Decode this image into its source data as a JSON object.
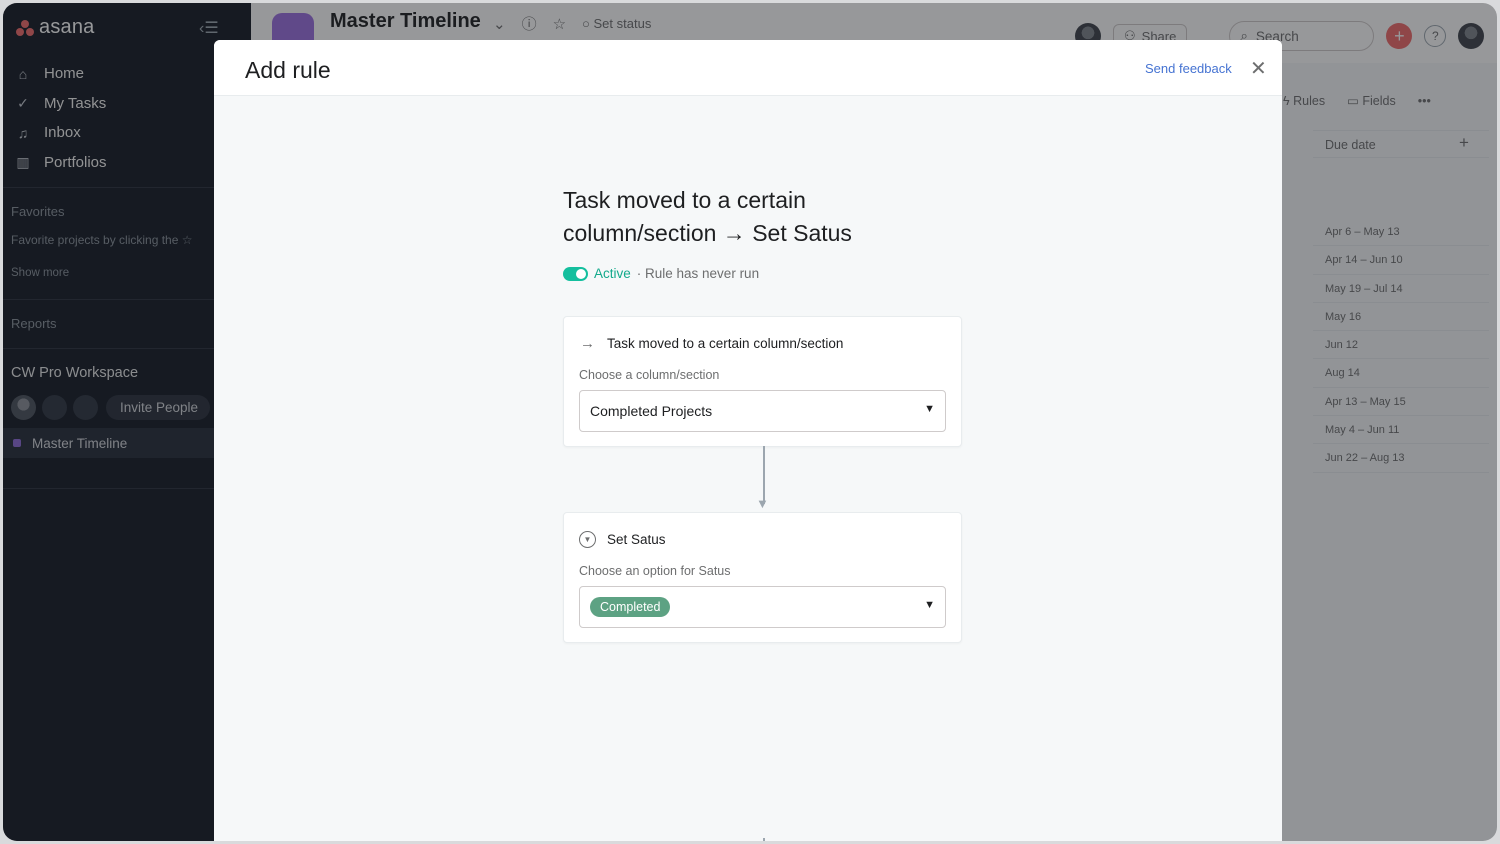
{
  "app": {
    "logo_text": "asana",
    "brand_color": "#f06a6a"
  },
  "sidebar": {
    "nav": [
      {
        "label": "Home",
        "icon": "home-icon"
      },
      {
        "label": "My Tasks",
        "icon": "check-circle-icon"
      },
      {
        "label": "Inbox",
        "icon": "bell-icon"
      },
      {
        "label": "Portfolios",
        "icon": "bar-chart-icon"
      }
    ],
    "favorites_title": "Favorites",
    "favorites_hint": "Favorite projects by clicking the ☆",
    "show_more": "Show more",
    "reports_title": "Reports",
    "workspace_name": "CW Pro Workspace",
    "invite_label": "Invite People",
    "project_name": "Master Timeline"
  },
  "header": {
    "project_title": "Master Timeline",
    "set_status": "Set status",
    "share_label": "Share",
    "search_placeholder": "Search",
    "help_label": "?"
  },
  "toolbar": {
    "rules_label": "Rules",
    "fields_label": "Fields",
    "more_label": "•••"
  },
  "table": {
    "due_date_header": "Due date",
    "due_dates": [
      "Apr 6 – May 13",
      "Apr 14 – Jun 10",
      "May 19 – Jul 14",
      "May 16",
      "Jun 12",
      "Aug 14",
      "Apr 13 – May 15",
      "May 4 – Jun 11",
      "Jun 22 – Aug 13"
    ]
  },
  "modal": {
    "title": "Add rule",
    "feedback_label": "Send feedback",
    "rule_title": "Task moved to a certain column/section → Set Satus",
    "status_active": "Active",
    "status_note": "· Rule has never run",
    "trigger": {
      "heading": "Task moved to a certain column/section",
      "label": "Choose a column/section",
      "value": "Completed Projects"
    },
    "action": {
      "heading": "Set Satus",
      "label": "Choose an option for Satus",
      "value": "Completed",
      "pill_color": "#5da283"
    }
  }
}
